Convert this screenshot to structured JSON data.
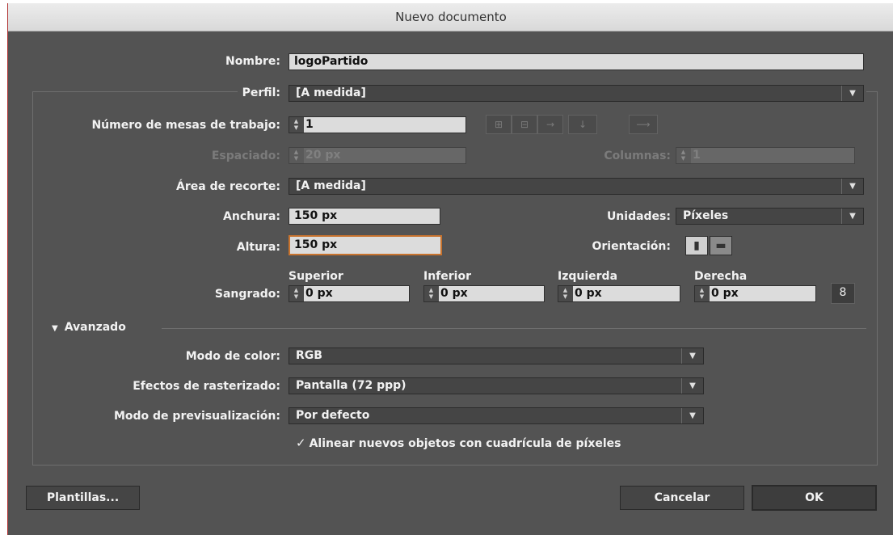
{
  "window": {
    "title": "Nuevo documento"
  },
  "form": {
    "nombre": {
      "label": "Nombre:",
      "value": "logoPartido"
    },
    "perfil": {
      "label": "Perfil:",
      "value": "[A medida]"
    },
    "mesas": {
      "label": "Número de mesas de trabajo:",
      "value": "1"
    },
    "espaciado": {
      "label": "Espaciado:",
      "value": "20 px"
    },
    "columnas": {
      "label": "Columnas:",
      "value": "1"
    },
    "area": {
      "label": "Área de recorte:",
      "value": "[A medida]"
    },
    "anchura": {
      "label": "Anchura:",
      "value": "150 px"
    },
    "unidades": {
      "label": "Unidades:",
      "value": "Píxeles"
    },
    "altura": {
      "label": "Altura:",
      "value": "150 px"
    },
    "orientacion": {
      "label": "Orientación:"
    },
    "sangrado": {
      "label": "Sangrado:",
      "superior": {
        "label": "Superior",
        "value": "0 px"
      },
      "inferior": {
        "label": "Inferior",
        "value": "0 px"
      },
      "izquierda": {
        "label": "Izquierda",
        "value": "0 px"
      },
      "derecha": {
        "label": "Derecha",
        "value": "0 px"
      }
    }
  },
  "avanzado": {
    "label": "Avanzado",
    "expanded": true,
    "modo_color": {
      "label": "Modo de color:",
      "value": "RGB"
    },
    "efectos": {
      "label": "Efectos de rasterizado:",
      "value": "Pantalla (72 ppp)"
    },
    "previsualizacion": {
      "label": "Modo de previsualización:",
      "value": "Por defecto"
    },
    "alinear": {
      "label": "Alinear nuevos objetos con cuadrícula de píxeles",
      "checked": true
    }
  },
  "buttons": {
    "plantillas": "Plantillas...",
    "cancelar": "Cancelar",
    "ok": "OK"
  },
  "icons": {
    "dropdown_arrow": "chevron-down-icon",
    "spinner": "stepper-arrows-icon",
    "link": "link-icon",
    "portrait": "portrait-icon",
    "landscape": "landscape-icon"
  }
}
